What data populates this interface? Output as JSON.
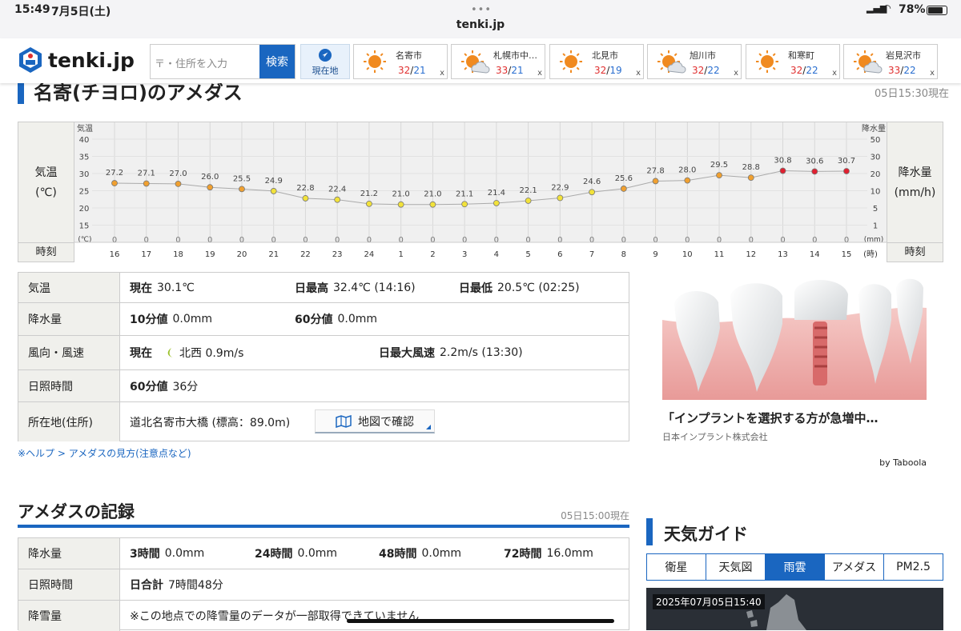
{
  "status_bar": {
    "time": "15:49",
    "date": "7月5日(土)",
    "url": "tenki.jp",
    "battery": "78%"
  },
  "header": {
    "logo_text": "tenki.jp",
    "search_placeholder": "〒・住所を入力",
    "search_button": "検索",
    "current_location_button": "現在地",
    "cities": [
      {
        "name": "名寄市",
        "high": "32",
        "low": "21",
        "icon": "sun-icon",
        "close": "x"
      },
      {
        "name": "札幌市中…",
        "high": "33",
        "low": "21",
        "icon": "sun-cloud-icon",
        "close": "x"
      },
      {
        "name": "北見市",
        "high": "32",
        "low": "19",
        "icon": "sun-icon",
        "close": "x"
      },
      {
        "name": "旭川市",
        "high": "32",
        "low": "22",
        "icon": "sun-cloud-icon",
        "close": "x"
      },
      {
        "name": "和寒町",
        "high": "32",
        "low": "22",
        "icon": "sun-icon",
        "close": "x"
      },
      {
        "name": "岩見沢市",
        "high": "33",
        "low": "22",
        "icon": "sun-cloud-icon",
        "close": "x"
      }
    ]
  },
  "page_title": "名寄(チヨロ)のアメダス",
  "as_of": "05日15:30現在",
  "chart_data": {
    "type": "line",
    "left_label": "気温",
    "left_unit": "(℃)",
    "right_label": "降水量",
    "right_unit": "(mm/h)",
    "time_label": "時刻",
    "left_axis_title": "気温",
    "left_axis_unit": "(℃)",
    "right_axis_title": "降水量",
    "right_axis_unit": "(mm)",
    "hour_unit": "(時)",
    "left_ticks": [
      "40",
      "35",
      "30",
      "25",
      "20",
      "15"
    ],
    "right_ticks": [
      "50",
      "30",
      "20",
      "10",
      "5",
      "1"
    ],
    "ylim": [
      10,
      40
    ],
    "hours": [
      "16",
      "17",
      "18",
      "19",
      "20",
      "21",
      "22",
      "23",
      "24",
      "1",
      "2",
      "3",
      "4",
      "5",
      "6",
      "7",
      "8",
      "9",
      "10",
      "11",
      "12",
      "13",
      "14",
      "15"
    ],
    "temperature": [
      27.2,
      27.1,
      27.0,
      26.0,
      25.5,
      24.9,
      22.8,
      22.4,
      21.2,
      21.0,
      21.0,
      21.1,
      21.4,
      22.1,
      22.9,
      24.6,
      25.6,
      27.8,
      28.0,
      29.5,
      28.8,
      30.8,
      30.6,
      30.7
    ],
    "temperature_labels": [
      "27.2",
      "27.1",
      "27.0",
      "26.0",
      "25.5",
      "24.9",
      "22.8",
      "22.4",
      "21.2",
      "21.0",
      "21.0",
      "21.1",
      "21.4",
      "22.1",
      "22.9",
      "24.6",
      "25.6",
      "27.8",
      "28.0",
      "29.5",
      "28.8",
      "30.8",
      "30.6",
      "30.7"
    ],
    "precipitation": [
      0,
      0,
      0,
      0,
      0,
      0,
      0,
      0,
      0,
      0,
      0,
      0,
      0,
      0,
      0,
      0,
      0,
      0,
      0,
      0,
      0,
      0,
      0,
      0
    ],
    "precipitation_labels": [
      "0",
      "0",
      "0",
      "0",
      "0",
      "0",
      "0",
      "0",
      "0",
      "0",
      "0",
      "0",
      "0",
      "0",
      "0",
      "0",
      "0",
      "0",
      "0",
      "0",
      "0",
      "0",
      "0",
      "0"
    ],
    "point_colors": {
      "yellow": "#f2e23a",
      "orange": "#f0a030",
      "red": "#e02030"
    }
  },
  "current": {
    "temp_label": "気温",
    "now_label": "現在",
    "now_value": "30.1℃",
    "max_label": "日最高",
    "max_value": "32.4℃ (14:16)",
    "min_label": "日最低",
    "min_value": "20.5℃ (02:25)",
    "precip_label": "降水量",
    "p10_label": "10分値",
    "p10_value": "0.0mm",
    "p60_label": "60分値",
    "p60_value": "0.0mm",
    "wind_label": "風向・風速",
    "wind_now_label": "現在",
    "wind_now_value": "北西 0.9m/s",
    "wind_max_label": "日最大風速",
    "wind_max_value": "2.2m/s (13:30)",
    "sun_label": "日照時間",
    "sun60_label": "60分値",
    "sun60_value": "36分",
    "loc_label": "所在地(住所)",
    "loc_value": "道北名寄市大橋 (標高：89.0m)",
    "map_button": "地図で確認"
  },
  "help_link": "※ヘルプ > アメダスの見方(注意点など)",
  "ad": {
    "headline": "「インプラントを選択する方が急増中…",
    "sponsor": "日本インプラント株式会社",
    "network": "by Taboola"
  },
  "records": {
    "title": "アメダスの記録",
    "as_of": "05日15:00現在",
    "precip_label": "降水量",
    "h3_label": "3時間",
    "h3_value": "0.0mm",
    "h24_label": "24時間",
    "h24_value": "0.0mm",
    "h48_label": "48時間",
    "h48_value": "0.0mm",
    "h72_label": "72時間",
    "h72_value": "16.0mm",
    "sun_label": "日照時間",
    "sun_total_label": "日合計",
    "sun_total_value": "7時間48分",
    "snow_label": "降雪量",
    "snow_note": "※この地点での降雪量のデータが一部取得できていません"
  },
  "guide": {
    "title": "天気ガイド",
    "tabs": [
      "衛星",
      "天気図",
      "雨雲",
      "アメダス",
      "PM2.5"
    ],
    "active_tab": "雨雲",
    "map_timestamp": "2025年07月05日15:40"
  }
}
